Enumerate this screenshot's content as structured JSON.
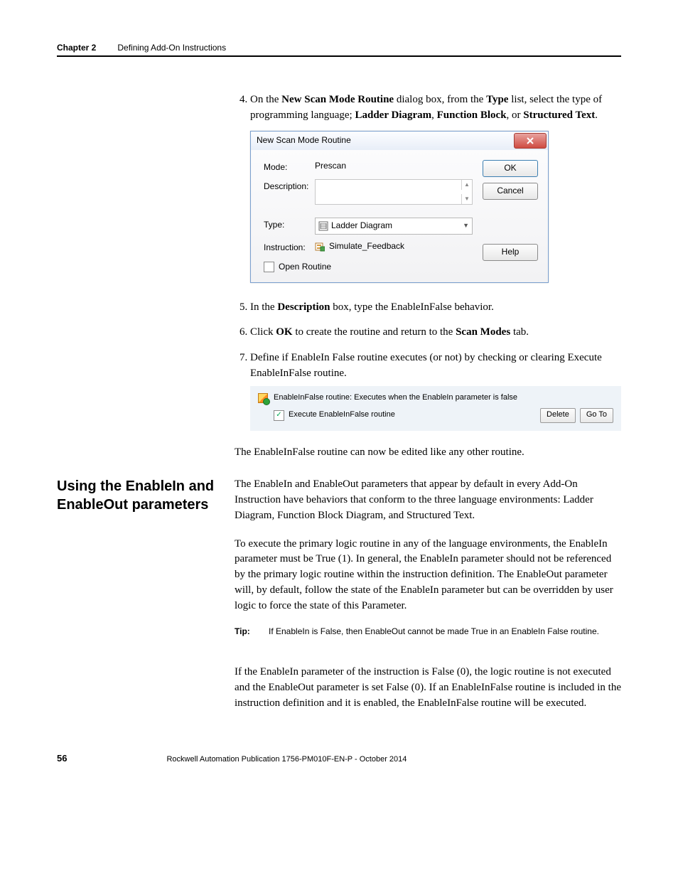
{
  "header": {
    "chapter": "Chapter 2",
    "title": "Defining Add-On Instructions"
  },
  "steps4to7": {
    "s4_pre": "On the ",
    "s4_b1": "New Scan Mode Routine",
    "s4_mid1": " dialog box, from the ",
    "s4_b2": "Type",
    "s4_mid2": " list, select the type of programming language; ",
    "s4_b3": "Ladder Diagram",
    "s4_c1": ", ",
    "s4_b4": "Function Block",
    "s4_c2": ", or ",
    "s4_b5": "Structured Text",
    "s4_end": ".",
    "s5_pre": "In the ",
    "s5_b1": "Description",
    "s5_end": " box, type the EnableInFalse behavior.",
    "s6_pre": "Click ",
    "s6_b1": "OK",
    "s6_mid": " to create the routine and return to the ",
    "s6_b2": "Scan Modes",
    "s6_end": " tab.",
    "s7": "Define if EnableIn False routine executes (or not) by checking or clearing Execute EnableInFalse routine."
  },
  "dialog": {
    "title": "New Scan Mode Routine",
    "labels": {
      "mode": "Mode:",
      "description": "Description:",
      "type": "Type:",
      "instruction": "Instruction:"
    },
    "values": {
      "mode": "Prescan",
      "type": "Ladder Diagram",
      "instruction": "Simulate_Feedback"
    },
    "open_routine": "Open Routine",
    "buttons": {
      "ok": "OK",
      "cancel": "Cancel",
      "help": "Help"
    }
  },
  "panel": {
    "line1": "EnableInFalse routine: Executes when the EnableIn parameter is false",
    "checkbox_label": "Execute EnableInFalse routine",
    "checked": true,
    "buttons": {
      "delete": "Delete",
      "goto": "Go To"
    }
  },
  "after_panel": "The EnableInFalse routine can now be edited like any other routine.",
  "section_heading": "Using the EnableIn and EnableOut parameters",
  "para1": "The EnableIn and EnableOut parameters that appear by default in every Add-On Instruction have behaviors that conform to the three language environments: Ladder Diagram, Function Block Diagram, and Structured Text.",
  "para2": "To execute the primary logic routine in any of the language environments, the EnableIn parameter must be True (1). In general, the EnableIn parameter should not be referenced by the primary logic routine within the instruction definition. The EnableOut parameter will, by default, follow the state of the EnableIn parameter but can be overridden by user logic to force the state of this Parameter.",
  "tip": {
    "label": "Tip:",
    "text": "If EnableIn is False, then EnableOut cannot be made True in an EnableIn False routine."
  },
  "para3": "If the EnableIn parameter of the instruction is False (0), the logic routine is not executed and the EnableOut parameter is set False (0). If an EnableInFalse routine is included in the instruction definition and it is enabled, the EnableInFalse routine will be executed.",
  "footer": {
    "page": "56",
    "publication": "Rockwell Automation Publication 1756-PM010F-EN-P - October 2014"
  }
}
